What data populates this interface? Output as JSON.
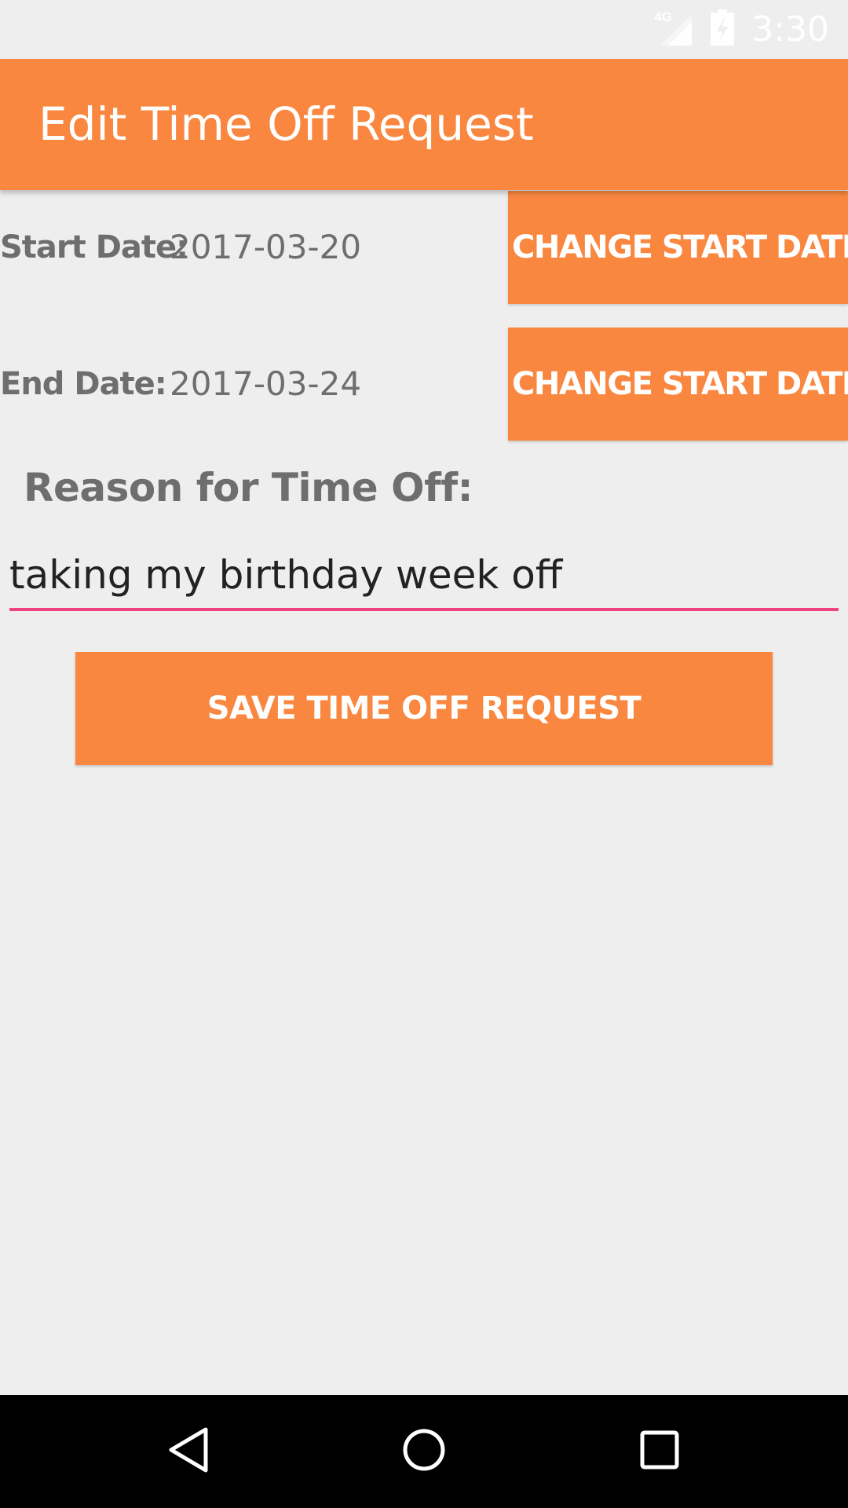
{
  "status_bar": {
    "network": "4G",
    "time": "3:30"
  },
  "app_bar": {
    "title": "Edit Time Off Request"
  },
  "start_date": {
    "label": "Start Date:",
    "value": "2017-03-20",
    "button_label": "CHANGE START DATE"
  },
  "end_date": {
    "label": "End Date:",
    "value": "2017-03-24",
    "button_label": "CHANGE START DATE"
  },
  "reason": {
    "heading": "Reason for Time Off:",
    "value": "taking my birthday week off"
  },
  "save_button": {
    "label": "SAVE TIME OFF REQUEST"
  },
  "nav_bar": {
    "icons": [
      "back-icon",
      "home-icon",
      "recents-icon"
    ]
  },
  "colors": {
    "accent": "#f9873f",
    "input_underline": "#ef4481",
    "background": "#eeeeee",
    "label_text": "#6e6e6e"
  }
}
